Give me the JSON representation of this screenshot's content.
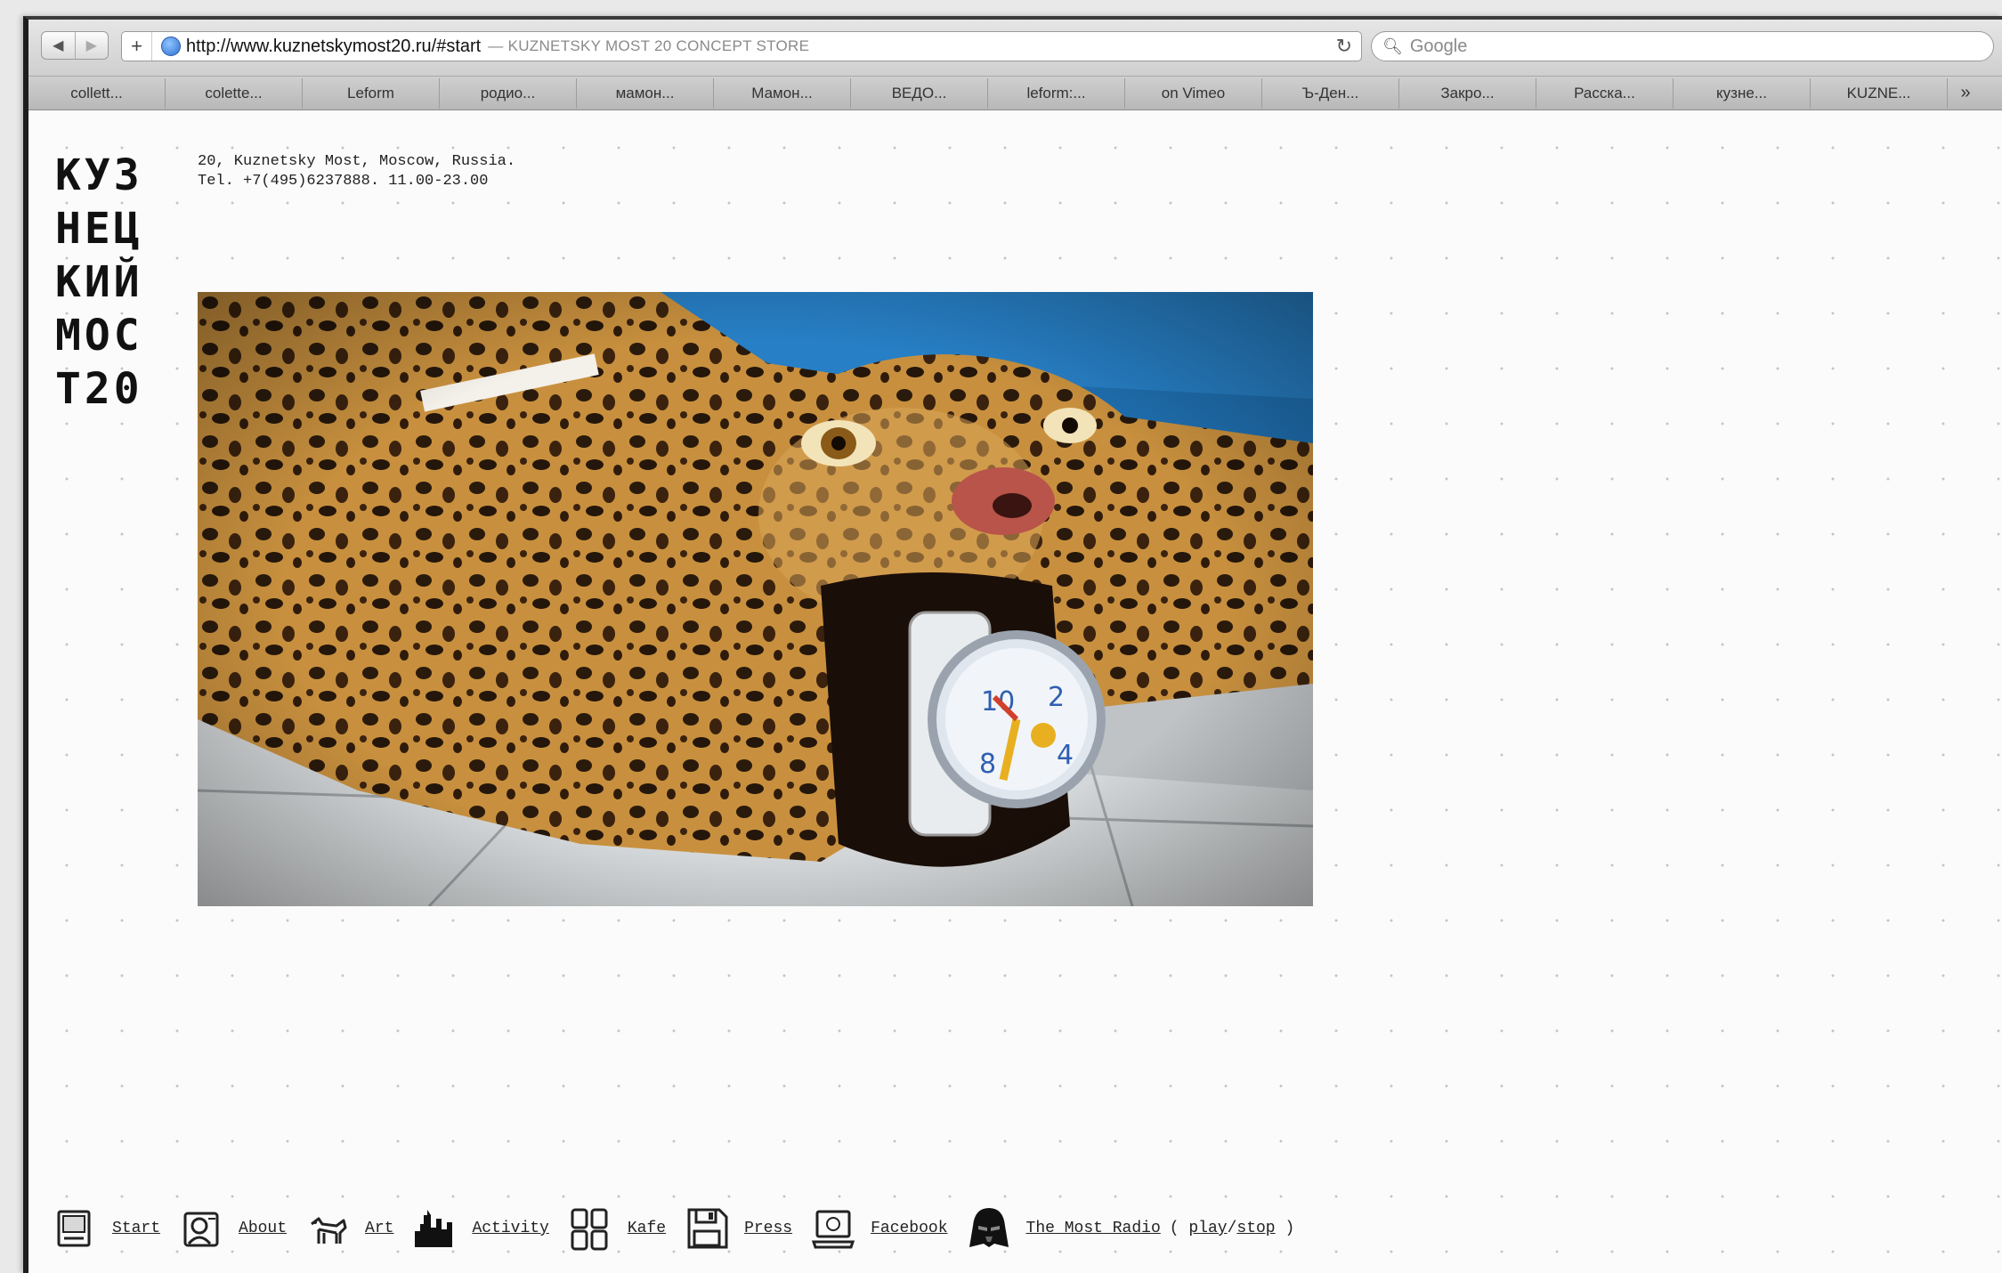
{
  "browser": {
    "url": "http://www.kuznetskymost20.ru/#start",
    "page_title": "— KUZNETSKY MOST 20 CONCEPT STORE",
    "search_placeholder": "Google",
    "bookmarks": [
      "collett...",
      "colette...",
      "Leform",
      "родио...",
      "мамон...",
      "Мамон...",
      "ВЕДО...",
      "leform:...",
      "on Vimeo",
      "Ъ-Ден...",
      "Закро...",
      "Расска...",
      "кузне...",
      "KUZNE..."
    ],
    "bookmarks_more": "»"
  },
  "site": {
    "logo_lines": [
      "КУЗ",
      "НЕЦ",
      "КИЙ",
      "МОС",
      "Т20"
    ],
    "address_line1": "20, Kuznetsky Most, Moscow, Russia.",
    "address_line2": "Tel. +7(495)6237888. 11.00-23.00"
  },
  "nav": {
    "items": [
      {
        "label": "Start",
        "icon": "computer-icon"
      },
      {
        "label": "About",
        "icon": "id-card-icon"
      },
      {
        "label": "Art",
        "icon": "dog-icon"
      },
      {
        "label": "Activity",
        "icon": "city-skyline-icon"
      },
      {
        "label": "Kafe",
        "icon": "grid-icon"
      },
      {
        "label": "Press",
        "icon": "floppy-disk-icon"
      },
      {
        "label": "Facebook",
        "icon": "laptop-icon"
      },
      {
        "label": "The Most Radio",
        "icon": "darth-vader-icon"
      }
    ],
    "radio_open": "(",
    "radio_play": "play",
    "radio_sep": "/",
    "radio_stop": "stop",
    "radio_close": ")"
  }
}
